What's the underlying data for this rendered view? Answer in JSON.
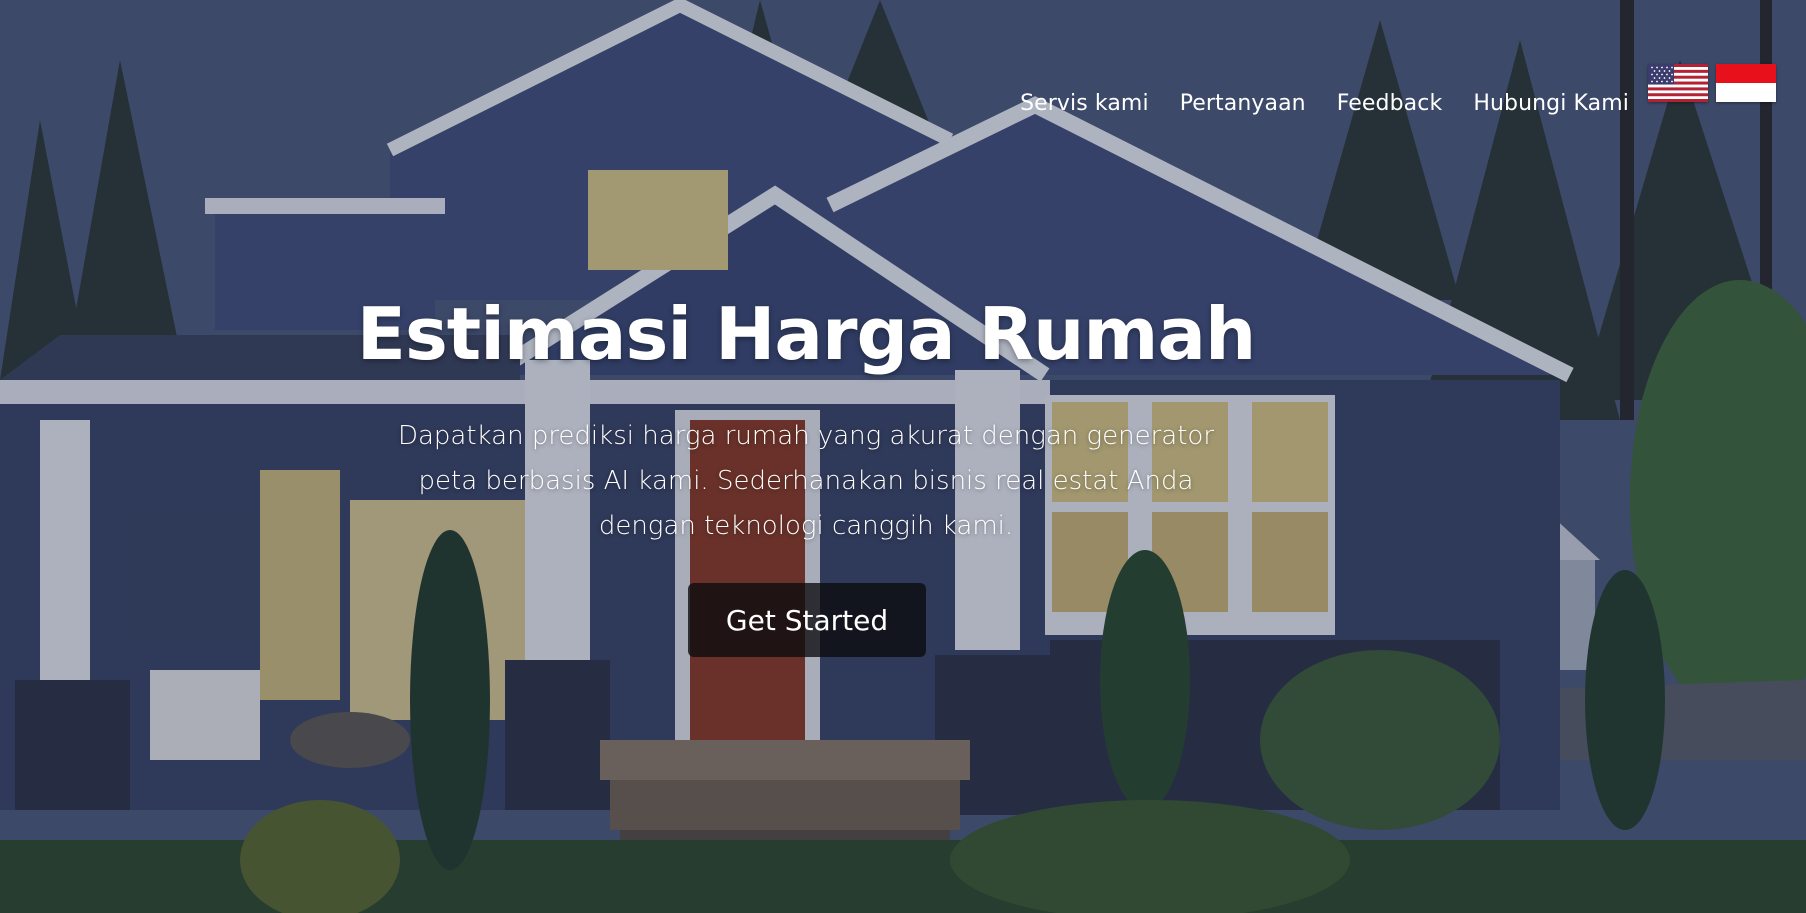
{
  "navbar": {
    "links": [
      {
        "label": "Servis kami"
      },
      {
        "label": "Pertanyaan"
      },
      {
        "label": "Feedback"
      },
      {
        "label": "Hubungi Kami"
      }
    ],
    "language_flags": [
      "us-flag",
      "indonesia-flag"
    ]
  },
  "hero": {
    "title": "Estimasi Harga Rumah",
    "description": "Dapatkan prediksi harga rumah yang akurat dengan generator peta berbasis AI kami. Sederhanakan bisnis real estat Anda dengan teknologi canggih kami.",
    "cta_label": "Get Started"
  },
  "colors": {
    "text": "#ffffff",
    "button_bg": "#0c0c0e",
    "house_siding": "#46527a",
    "flag_red": "#e8101a"
  }
}
